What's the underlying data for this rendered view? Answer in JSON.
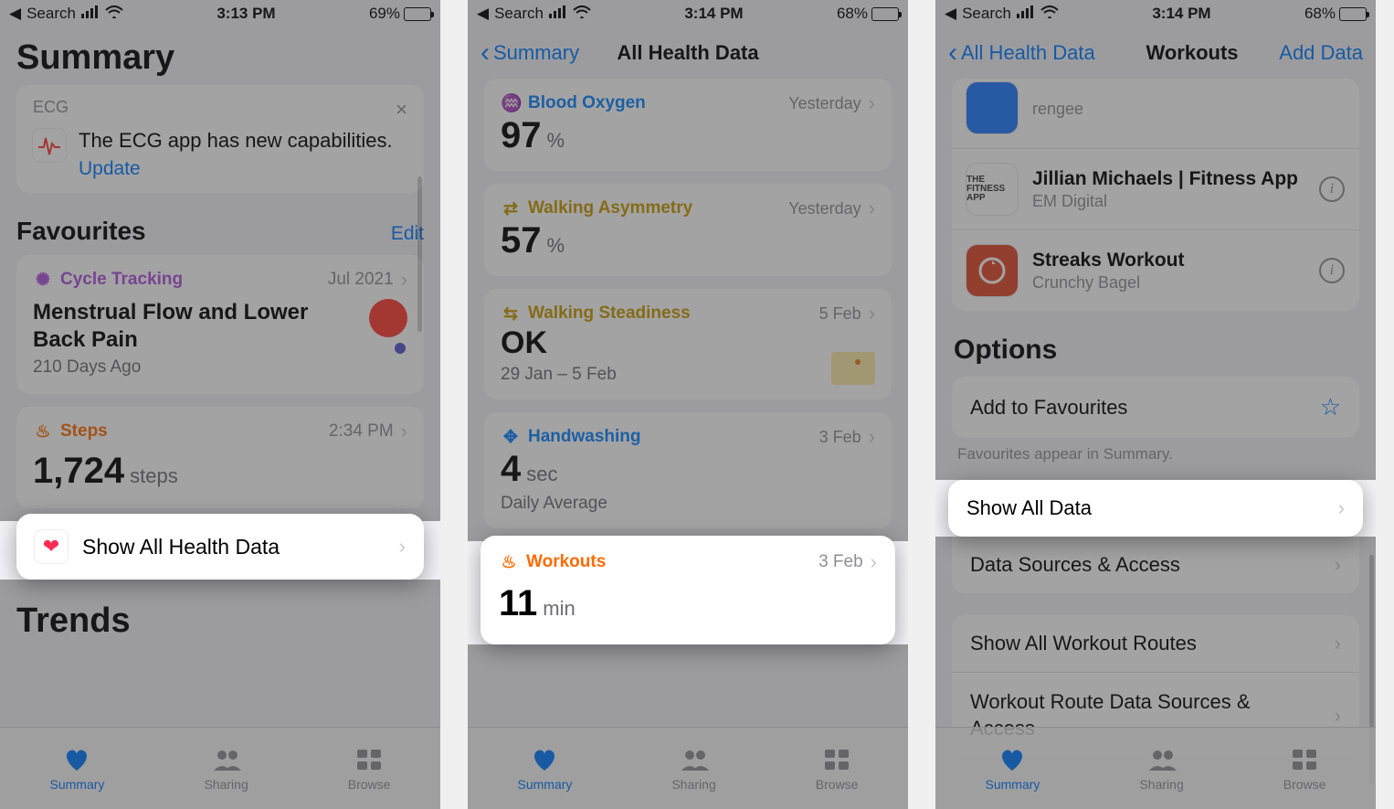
{
  "screens": [
    {
      "status": {
        "back": "Search",
        "time": "3:13 PM",
        "battery": "69%",
        "battery_fill": 69
      },
      "nav": {
        "title": "Summary"
      },
      "ecg": {
        "tag": "ECG",
        "text": "The ECG app has new capabilities.",
        "update": "Update"
      },
      "favourites": {
        "heading": "Favourites",
        "edit": "Edit",
        "cycle": {
          "label": "Cycle Tracking",
          "date": "Jul 2021",
          "title": "Menstrual Flow and Lower Back Pain",
          "sub": "210 Days Ago"
        },
        "steps": {
          "label": "Steps",
          "time": "2:34 PM",
          "value": "1,724",
          "unit": "steps"
        }
      },
      "showAll": "Show All Health Data",
      "trends": "Trends",
      "tabs": {
        "summary": "Summary",
        "sharing": "Sharing",
        "browse": "Browse"
      }
    },
    {
      "status": {
        "back": "Search",
        "time": "3:14 PM",
        "battery": "68%",
        "battery_fill": 68
      },
      "nav": {
        "back": "Summary",
        "title": "All Health Data"
      },
      "tiles": {
        "blood": {
          "label": "Blood Oxygen",
          "date": "Yesterday",
          "value": "97",
          "unit": "%"
        },
        "asym": {
          "label": "Walking Asymmetry",
          "date": "Yesterday",
          "value": "57",
          "unit": "%"
        },
        "stead": {
          "label": "Walking Steadiness",
          "date": "5 Feb",
          "value": "OK",
          "sub": "29 Jan – 5 Feb"
        },
        "hand": {
          "label": "Handwashing",
          "date": "3 Feb",
          "value": "4",
          "unit": "sec",
          "sub": "Daily Average"
        },
        "work": {
          "label": "Workouts",
          "date": "3 Feb",
          "value": "11",
          "unit": "min"
        }
      },
      "tabs": {
        "summary": "Summary",
        "sharing": "Sharing",
        "browse": "Browse"
      }
    },
    {
      "status": {
        "back": "Search",
        "time": "3:14 PM",
        "battery": "68%",
        "battery_fill": 68
      },
      "nav": {
        "back": "All Health Data",
        "title": "Workouts",
        "action": "Add Data"
      },
      "apps": {
        "a0": {
          "name_trunc": "rengee"
        },
        "a1": {
          "name": "Jillian Michaels | Fitness App",
          "dev": "EM Digital",
          "iconText": "THE FITNESS APP"
        },
        "a2": {
          "name": "Streaks Workout",
          "dev": "Crunchy Bagel"
        }
      },
      "options": {
        "heading": "Options",
        "fav": "Add to Favourites",
        "note": "Favourites appear in Summary.",
        "showAll": "Show All Data",
        "sources": "Data Sources & Access",
        "routes": "Show All Workout Routes",
        "routeSources": "Workout Route Data Sources & Access"
      },
      "tabs": {
        "summary": "Summary",
        "sharing": "Sharing",
        "browse": "Browse"
      }
    }
  ]
}
